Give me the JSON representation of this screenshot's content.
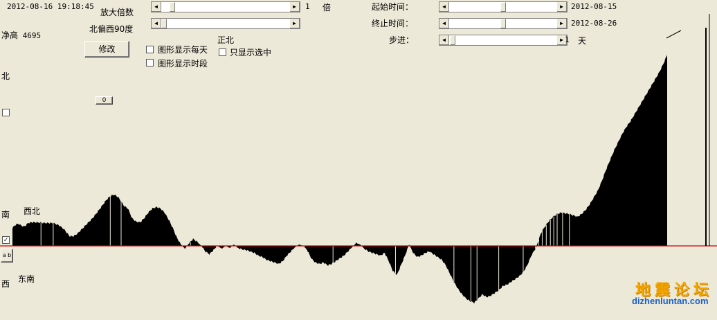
{
  "header": {
    "datetime": "2012-08-16 19:18:45",
    "net_height_label": "净高",
    "net_height_value": "4695"
  },
  "controls": {
    "zoom_label": "放大倍数",
    "zoom_value": "1",
    "zoom_unit": "倍",
    "north_offset_label": "北偏西90度",
    "modify_button": "修改",
    "show_daily_label": "图形显示每天",
    "show_period_label": "图形显示时段",
    "true_north_label": "正北",
    "show_selected_only_label": "只显示选中",
    "small_button": "0",
    "start_time_label": "起始时间：",
    "start_time_value": "2012-08-15",
    "end_time_label": "终止时间：",
    "end_time_value": "2012-08-26",
    "step_label": "步进：",
    "step_value": "1",
    "step_unit": "天",
    "ab_button": "a b"
  },
  "compass": {
    "north": "北",
    "south": "南",
    "west": "西",
    "northwest": "西北",
    "southeast": "东南"
  },
  "watermark": {
    "line1": "地震论坛",
    "line2": "dizhenluntan.com"
  },
  "colors": {
    "background": "#ece9d8",
    "baseline": "#cc0000",
    "fill": "#000000",
    "watermark_gold": "#f2a500",
    "watermark_blue": "#1a5fc9"
  },
  "chart_data": {
    "type": "area",
    "x": [
      0,
      4,
      8,
      12,
      16,
      19,
      23,
      28,
      36,
      48,
      60,
      68,
      76,
      84,
      90,
      96,
      102,
      110,
      118,
      126,
      132,
      138,
      144,
      150,
      156,
      160,
      164,
      170,
      176,
      182,
      188,
      194,
      200,
      206,
      212,
      218,
      224,
      230,
      236,
      242,
      248,
      254,
      260,
      266,
      272,
      278,
      284,
      290,
      296,
      302,
      308,
      314,
      320,
      326,
      332,
      338,
      344,
      350,
      356,
      362,
      368,
      374,
      380,
      386,
      392,
      398,
      404,
      410,
      416,
      422,
      428,
      434,
      440,
      446,
      452,
      458,
      464,
      470,
      476,
      482,
      488,
      494,
      500,
      506,
      512,
      518,
      524,
      530,
      536,
      542,
      548,
      554,
      560,
      566,
      572,
      578,
      584,
      590,
      596,
      602,
      608,
      614,
      620,
      626,
      632,
      638,
      644,
      650,
      656,
      662,
      668,
      674,
      680,
      686,
      692,
      698,
      704,
      710,
      716,
      722,
      728,
      734,
      740,
      746,
      752,
      758,
      764,
      770,
      774,
      778,
      784,
      790,
      796,
      802,
      808,
      814,
      820,
      826,
      832,
      838,
      844,
      850,
      856,
      862,
      868,
      874,
      880,
      886,
      892,
      898,
      904,
      910,
      916,
      922,
      928,
      934,
      940,
      946,
      952,
      958,
      964
    ],
    "y": [
      26,
      30,
      32,
      30,
      28,
      29,
      33,
      34,
      34,
      33,
      33,
      30,
      24,
      14,
      14,
      18,
      24,
      32,
      40,
      50,
      58,
      66,
      72,
      74,
      70,
      64,
      58,
      54,
      40,
      35,
      34,
      40,
      48,
      54,
      56,
      54,
      48,
      38,
      26,
      12,
      2,
      -4,
      4,
      10,
      6,
      0,
      -8,
      -12,
      -6,
      0,
      -4,
      0,
      -3,
      2,
      -3,
      -5,
      -6,
      -8,
      -10,
      -14,
      -16,
      -20,
      -22,
      -24,
      -26,
      -22,
      -14,
      -8,
      -2,
      2,
      0,
      -6,
      -18,
      -24,
      -26,
      -24,
      -28,
      -26,
      -22,
      -18,
      -14,
      -8,
      -2,
      4,
      2,
      -4,
      -8,
      -10,
      -12,
      -14,
      -10,
      -22,
      -36,
      -42,
      -28,
      -14,
      2,
      -10,
      -16,
      -14,
      -10,
      -8,
      -12,
      -16,
      -20,
      -28,
      -40,
      -52,
      -62,
      -70,
      -76,
      -80,
      -82,
      -76,
      -70,
      -74,
      -72,
      -68,
      -64,
      -58,
      -56,
      -52,
      -48,
      -44,
      -38,
      -28,
      -14,
      -4,
      6,
      18,
      28,
      36,
      42,
      46,
      48,
      47,
      46,
      44,
      42,
      46,
      52,
      60,
      70,
      80,
      94,
      110,
      124,
      138,
      150,
      162,
      172,
      180,
      190,
      200,
      210,
      220,
      230,
      240,
      250,
      262,
      276,
      288,
      298,
      302
    ],
    "xlim": [
      0,
      964
    ],
    "ylim": [
      -90,
      310
    ],
    "baseline": 0
  }
}
